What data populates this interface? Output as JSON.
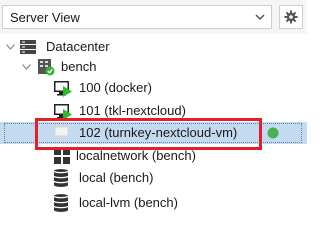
{
  "toolbar": {
    "view_selector_value": "Server View",
    "view_selector_icon": "chevron-down-icon",
    "settings_icon": "gear-icon"
  },
  "tree": {
    "datacenter": {
      "label": "Datacenter",
      "icon": "datacenter-icon",
      "expanded": true
    },
    "node": {
      "label": "bench",
      "icon": "node-online-icon",
      "expanded": true,
      "status": "online"
    },
    "guests": [
      {
        "label": "100 (docker)",
        "icon": "vm-running-icon",
        "status": "running"
      },
      {
        "label": "101 (tkl-nextcloud)",
        "icon": "vm-running-icon",
        "status": "running"
      },
      {
        "label": "102 (turnkey-nextcloud-vm)",
        "icon": "vm-stopped-icon",
        "status": "stopped",
        "selected": true,
        "highlighted": true,
        "tag_color": "#4caf50"
      }
    ],
    "network": {
      "label": "localnetwork (bench)",
      "icon": "sdn-zone-icon"
    },
    "storages": [
      {
        "label": "local (bench)",
        "icon": "storage-icon"
      },
      {
        "label": "local-lvm (bench)",
        "icon": "storage-icon"
      }
    ]
  },
  "colors": {
    "selection_background": "#c3daf1",
    "highlight_border": "#e0212b",
    "status_green": "#2fb92f",
    "toolbar_background": "#f5f5f5"
  }
}
